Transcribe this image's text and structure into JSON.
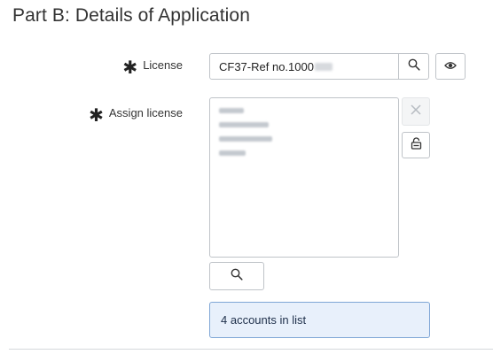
{
  "section": {
    "title": "Part B: Details of Application"
  },
  "license": {
    "required_mark": "✱",
    "label": "License",
    "value": "CF37-Ref no.1000",
    "search_icon": "search-icon",
    "preview_icon": "eye-icon"
  },
  "assign": {
    "required_mark": "✱",
    "label": "Assign license",
    "remove_icon": "close-icon",
    "unlock_icon": "unlock-icon",
    "lookup_icon": "search-icon"
  },
  "info": {
    "text": "4 accounts in list"
  },
  "colors": {
    "info_bg": "#e8f0fb",
    "info_border": "#7fa6d6",
    "border": "#bfc3c8"
  }
}
